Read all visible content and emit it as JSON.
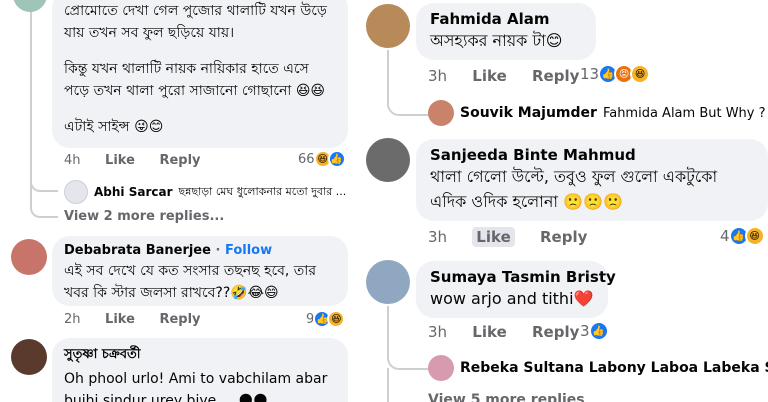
{
  "left": {
    "c1": {
      "text_lines": [
        "প্রোমোতে দেখা গেল পুজোর থালাটি যখন উড়ে",
        "যায় তখন সব ফুল ছড়িয়ে যায়।",
        "",
        "কিন্তু যখন থালাটি নায়ক নায়িকার হাতে এসে",
        "পড়ে তখন থালা পুরো সাজানো গোছানো 😆😆",
        "",
        "এটাই সাইন্স 😜😊"
      ],
      "time": "4h",
      "like": "Like",
      "reply": "Reply",
      "reactions_count": "66"
    },
    "c1_reply": {
      "name": "Abhi Sarcar",
      "text": "ছন্নছাড়া মেঘ ধুলোকনার মতো দুবার ..."
    },
    "c1_more": "View 2 more replies...",
    "c2": {
      "name": "Debabrata Banerjee",
      "sep": "·",
      "follow": "Follow",
      "text_lines": [
        "এই সব দেখে যে কত সংসার তছনছ হবে, তার",
        "খবর কি স্টার জলসা রাখবে??🤣😂😄"
      ],
      "time": "2h",
      "like": "Like",
      "reply": "Reply",
      "reactions_count": "9"
    },
    "c3": {
      "name": "সুতৃষ্ণা চক্রবর্তী",
      "text_lines": [
        "Oh phool urlo! Ami to vabchilam abar",
        "bujhi sindur urey biye.... 🌑🌑"
      ]
    }
  },
  "right": {
    "c1": {
      "name": "Fahmida Alam",
      "text": "অসহ্যকর নায়ক টা😊",
      "time": "3h",
      "like": "Like",
      "reply": "Reply",
      "reactions_count": "13"
    },
    "c1_reply": {
      "name": "Souvik Majumder",
      "text": "Fahmida Alam  But Why ?"
    },
    "c2": {
      "name": "Sanjeeda Binte Mahmud",
      "text_lines": [
        "থালা গেলো উল্টে, তবুও ফুল গুলো একটুকো",
        "এদিক ওদিক হলোনা 🙁🙁🙁"
      ],
      "time": "3h",
      "like": "Like",
      "reply": "Reply",
      "reactions_count": "4"
    },
    "c3": {
      "name": "Sumaya Tasmin Bristy",
      "text": "wow arjo and tithi❤️",
      "time": "3h",
      "like": "Like",
      "reply": "Reply",
      "reactions_count": "3"
    },
    "c3_reply": {
      "name": "Rebeka Sultana Labony Laboa Labeka Sultana"
    },
    "c3_more": "View 5 more replies"
  },
  "icons": {
    "like": "thumbs-up-icon",
    "haha": "laughing-emoji-icon",
    "angry": "angry-emoji-icon"
  },
  "colors": {
    "like_blue": "#1877f2",
    "bubble": "#f0f2f5",
    "meta_gray": "#65676b"
  }
}
